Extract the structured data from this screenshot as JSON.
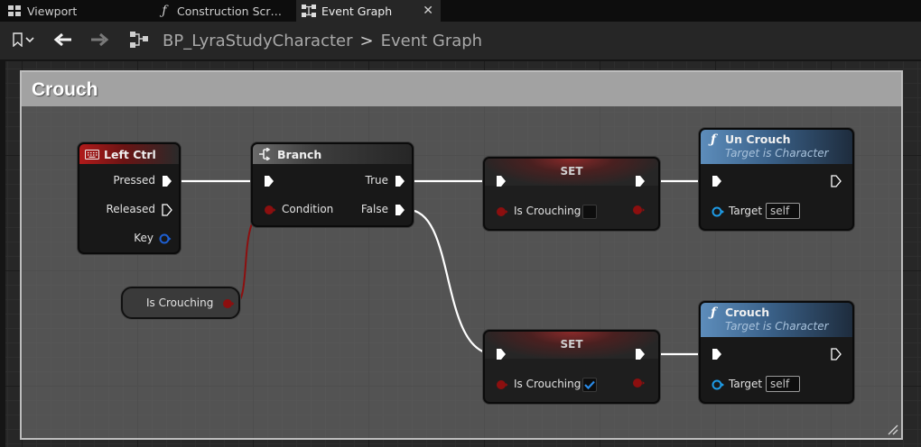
{
  "tabs": [
    {
      "label": "Viewport",
      "icon": "viewport-grid-icon"
    },
    {
      "label": "Construction Scr…",
      "icon": "function-icon"
    },
    {
      "label": "Event Graph",
      "icon": "event-graph-icon",
      "active": true,
      "close": "✕"
    }
  ],
  "toolbar": {
    "bookmark_icon": "bookmark-icon",
    "back_icon": "back-arrow-icon",
    "forward_icon": "forward-arrow-icon",
    "graph_icon": "graph-icon",
    "breadcrumb": [
      "BP_LyraStudyCharacter",
      "Event Graph"
    ],
    "separator": ">"
  },
  "graph": {
    "comment": "Crouch",
    "nodes": {
      "left_ctrl": {
        "title": "Left Ctrl",
        "pins": {
          "pressed": "Pressed",
          "released": "Released",
          "key": "Key"
        }
      },
      "branch": {
        "title": "Branch",
        "pins": {
          "condition": "Condition",
          "true": "True",
          "false": "False"
        }
      },
      "is_crouching_get": {
        "label": "Is Crouching"
      },
      "set_top": {
        "title": "SET",
        "variable": "Is Crouching",
        "value": false
      },
      "set_bottom": {
        "title": "SET",
        "variable": "Is Crouching",
        "value": true
      },
      "uncrouch": {
        "title": "Un Crouch",
        "subtitle": "Target is Character",
        "target_label": "Target",
        "target_value": "self"
      },
      "crouch": {
        "title": "Crouch",
        "subtitle": "Target is Character",
        "target_label": "Target",
        "target_value": "self"
      }
    }
  },
  "colors": {
    "exec_wire": "#ffffff",
    "bool_wire": "#8c0f0f",
    "bool_pin": "#8c0f0f",
    "object_pin": "#1e9be6",
    "key_pin": "#1e5fd2"
  }
}
